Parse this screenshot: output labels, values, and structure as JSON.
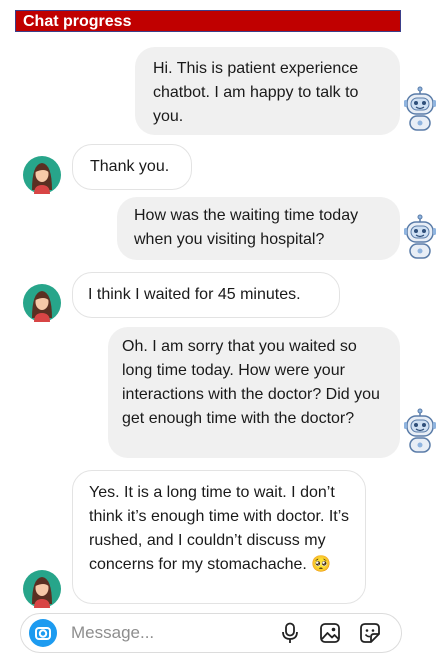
{
  "header": {
    "title": "Chat progress"
  },
  "messages": [
    {
      "sender": "bot",
      "text": "Hi. This is patient experience chatbot. I am happy to talk to you."
    },
    {
      "sender": "user",
      "text": "Thank you."
    },
    {
      "sender": "bot",
      "text": "How was the waiting time today when you visiting hospital?"
    },
    {
      "sender": "user",
      "text": "I think I waited for 45 minutes."
    },
    {
      "sender": "bot",
      "text": "Oh. I am sorry that you waited so long time today. How were your interactions with the doctor? Did you get enough time with the doctor?"
    },
    {
      "sender": "user",
      "text": "Yes. It is a long time to wait. I don’t think it’s enough time with doctor. It’s rushed, and I couldn’t discuss my concerns for my stomachache.",
      "emoji": "🥺"
    }
  ],
  "composer": {
    "placeholder": "Message..."
  },
  "icons": {
    "bot_avatar": "robot-icon",
    "user_avatar": "woman-avatar-icon",
    "camera": "camera-icon",
    "microphone": "microphone-icon",
    "gallery": "image-icon",
    "sticker": "sticker-icon"
  },
  "colors": {
    "header_bg": "#c00000",
    "header_border": "#3b3f8a",
    "bot_bubble": "#f0f0f0",
    "user_bubble": "#ffffff",
    "camera_button": "#1d9bf0"
  }
}
